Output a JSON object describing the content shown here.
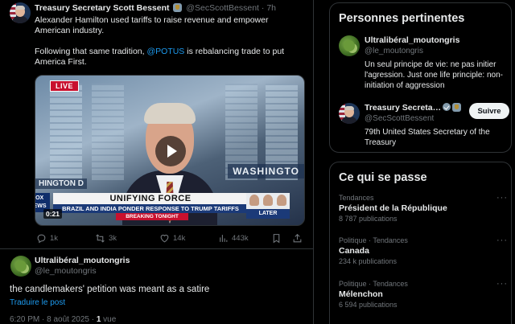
{
  "tweet": {
    "author_name": "Treasury Secretary Scott Bessent",
    "author_handle": "@SecScottBessent",
    "time": "· 7h",
    "text_line1": "Alexander Hamilton used tariffs to raise revenue and empower American industry.",
    "text_line2_pre": "Following that same tradition, ",
    "text_line2_mention": "@POTUS",
    "text_line2_post": " is rebalancing trade to put America First.",
    "video": {
      "live_label": "LIVE",
      "background_sign": "WASHINGTO",
      "background_sign_left": "HINGTON D",
      "network": "FOX NEWS",
      "headline": "UNIFYING FORCE",
      "subheadline": "BRAZIL AND INDIA PONDER RESPONSE TO TRUMP TARIFFS",
      "breaking": "BREAKING TONIGHT",
      "panel_label": "LATER",
      "elapsed": "0:21"
    },
    "actions": {
      "replies": "1k",
      "reposts": "3k",
      "likes": "14k",
      "views": "443k"
    }
  },
  "reply": {
    "author_name": "Ultralibéral_moutongris",
    "author_handle": "@le_moutongris",
    "text": "the candlemakers' petition was meant as a satire",
    "translate_label": "Traduire le post",
    "timestamp": "6:20 PM · 8 août 2025 · ",
    "views_count": "1",
    "views_label": " vue"
  },
  "relevant_people": {
    "title": "Personnes pertinentes",
    "people": [
      {
        "name": "Ultralibéral_moutongris",
        "handle": "@le_moutongris",
        "bio": "Un seul principe de vie: ne pas initier l'agression. Just one life principle: non-initiation of aggression"
      },
      {
        "name": "Treasury Secreta…",
        "handle": "@SecScottBessent",
        "bio": "79th United States Secretary of the Treasury",
        "follow_label": "Suivre"
      }
    ]
  },
  "happening": {
    "title": "Ce qui se passe",
    "trends": [
      {
        "context": "Tendances",
        "name": "Président de la République",
        "count": "8 787 publications"
      },
      {
        "context": "Politique · Tendances",
        "name": "Canada",
        "count": "234 k publications"
      },
      {
        "context": "Politique · Tendances",
        "name": "Mélenchon",
        "count": "6 594 publications"
      }
    ]
  },
  "colors": {
    "background": "#000000",
    "text": "#e7e9ea",
    "muted": "#71767b",
    "accent": "#1d9bf0",
    "border": "#2f3336"
  }
}
